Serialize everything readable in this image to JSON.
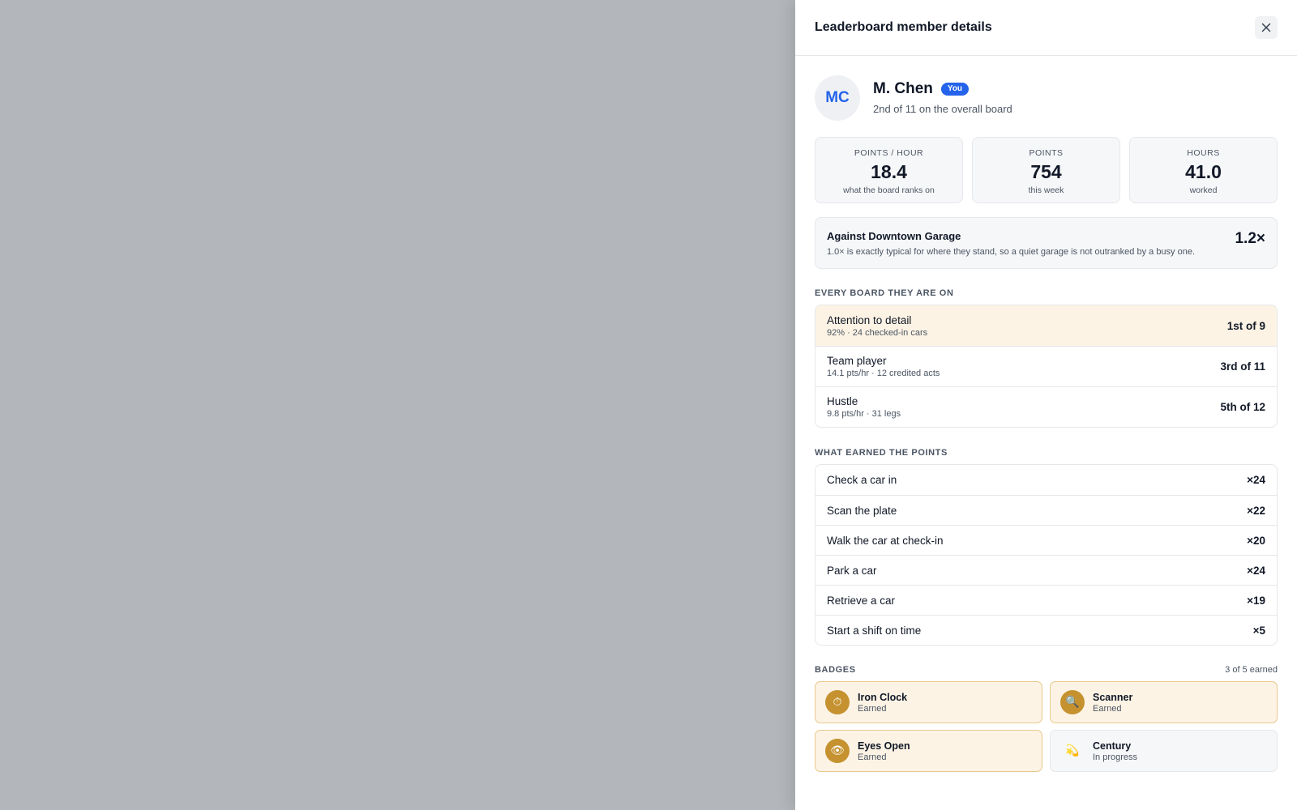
{
  "drawer": {
    "title": "Leaderboard member details",
    "close_icon": "close-icon"
  },
  "member": {
    "initials": "MC",
    "name": "M. Chen",
    "you_label": "You",
    "rank_summary": "2nd of 11 on the overall board"
  },
  "stats": [
    {
      "label": "Points / hour",
      "value": "18.4",
      "sub": "what the board ranks on"
    },
    {
      "label": "Points",
      "value": "754",
      "sub": "this week"
    },
    {
      "label": "Hours",
      "value": "41.0",
      "sub": "worked"
    }
  ],
  "comparison": {
    "title": "Against Downtown Garage",
    "description": "1.0× is exactly typical for where they stand, so a quiet garage is not outranked by a busy one.",
    "value": "1.2×"
  },
  "boards": {
    "title": "Every board they are on",
    "items": [
      {
        "name": "Attention to detail",
        "detail": "92% · 24 checked-in cars",
        "rank": "1st of 9",
        "highlight": true
      },
      {
        "name": "Team player",
        "detail": "14.1 pts/hr · 12 credited acts",
        "rank": "3rd of 11",
        "highlight": false
      },
      {
        "name": "Hustle",
        "detail": "9.8 pts/hr · 31 legs",
        "rank": "5th of 12",
        "highlight": false
      }
    ]
  },
  "points": {
    "title": "What earned the points",
    "items": [
      {
        "label": "Check a car in",
        "count": "×24"
      },
      {
        "label": "Scan the plate",
        "count": "×22"
      },
      {
        "label": "Walk the car at check-in",
        "count": "×20"
      },
      {
        "label": "Park a car",
        "count": "×24"
      },
      {
        "label": "Retrieve a car",
        "count": "×19"
      },
      {
        "label": "Start a shift on time",
        "count": "×5"
      }
    ]
  },
  "badges": {
    "title": "Badges",
    "count": "3 of 5 earned",
    "items": [
      {
        "name": "Iron Clock",
        "status": "Earned",
        "icon": "stopwatch-icon",
        "glyph": "⏱",
        "earned": true
      },
      {
        "name": "Scanner",
        "status": "Earned",
        "icon": "magnifier-icon",
        "glyph": "🔍",
        "earned": true
      },
      {
        "name": "Eyes Open",
        "status": "Earned",
        "icon": "eye-icon",
        "glyph": "👁",
        "earned": true
      },
      {
        "name": "Century",
        "status": "In progress",
        "icon": "century-icon",
        "glyph": "💫",
        "earned": false
      }
    ]
  },
  "colors": {
    "accent": "#2563eb",
    "badge_gold": "#c5922f",
    "highlight_bg": "#fcf3e4",
    "backdrop": "#b3b6ba"
  }
}
